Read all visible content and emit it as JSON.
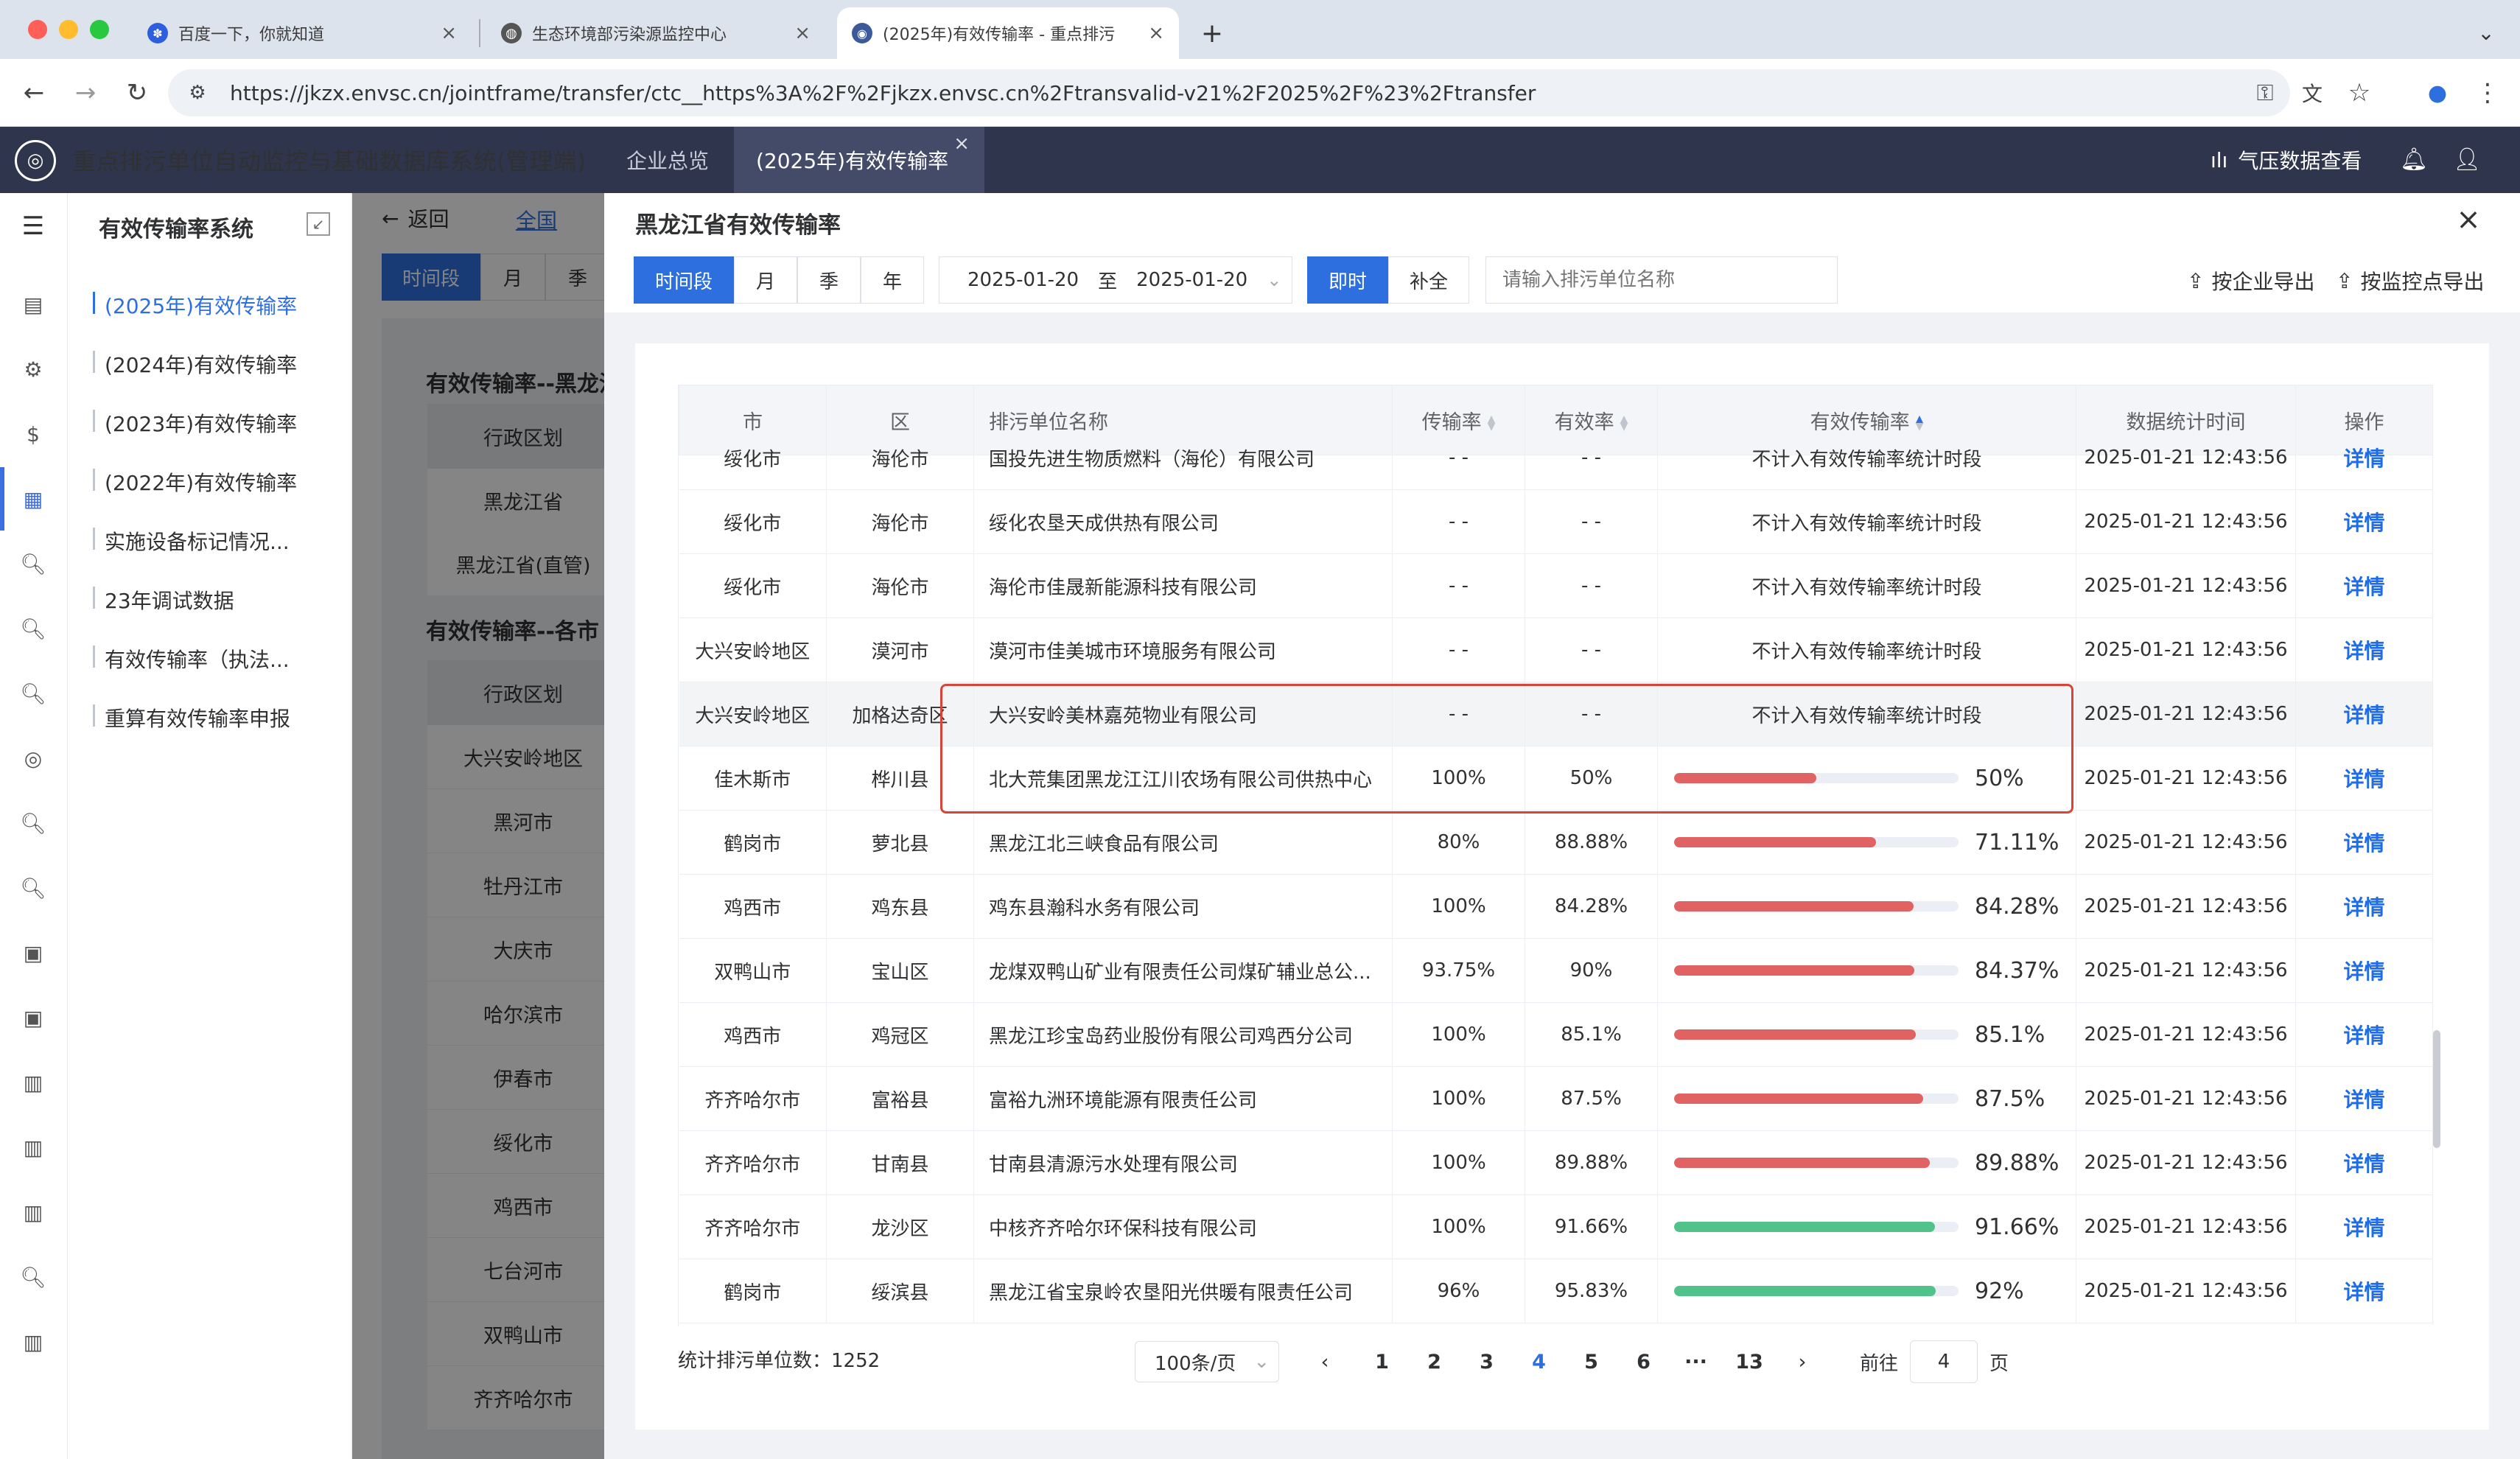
{
  "browser": {
    "tabs": [
      {
        "title": "百度一下，你就知道"
      },
      {
        "title": "生态环境部污染源监控中心"
      },
      {
        "title": "(2025年)有效传输率 - 重点排污"
      }
    ],
    "new_tab": "+",
    "url": "https://jkzx.envsc.cn/jointframe/transfer/ctc__https%3A%2F%2Fjkzx.envsc.cn%2Ftransvalid-v21%2F2025%2F%23%2Ftransfer"
  },
  "app": {
    "title": "重点排污单位自动监控与基础数据库系统(管理端)",
    "nav_tabs": [
      {
        "label": "企业总览"
      },
      {
        "label": "(2025年)有效传输率"
      }
    ],
    "pressure_link": "气压数据查看"
  },
  "submenu": {
    "title": "有效传输率系统",
    "items": [
      {
        "label": "(2025年)有效传输率"
      },
      {
        "label": "(2024年)有效传输率"
      },
      {
        "label": "(2023年)有效传输率"
      },
      {
        "label": "(2022年)有效传输率"
      },
      {
        "label": "实施设备标记情况..."
      },
      {
        "label": "23年调试数据"
      },
      {
        "label": "有效传输率（执法..."
      },
      {
        "label": "重算有效传输率申报"
      }
    ]
  },
  "background_page": {
    "back_label": "返回",
    "breadcrumb": "全国",
    "period_tabs": [
      "时间段",
      "月",
      "季"
    ],
    "section1_title": "有效传输率--黑龙江",
    "section1_header": "行政区划",
    "section1_rows": [
      "黑龙江省",
      "黑龙江省(直管)"
    ],
    "section2_title": "有效传输率--各市",
    "section2_header": "行政区划",
    "section2_rows": [
      "大兴安岭地区",
      "黑河市",
      "牡丹江市",
      "大庆市",
      "哈尔滨市",
      "伊春市",
      "绥化市",
      "鸡西市",
      "七台河市",
      "双鸭山市",
      "齐齐哈尔市"
    ]
  },
  "drawer": {
    "title": "黑龙江省有效传输率",
    "period_tabs": [
      "时间段",
      "月",
      "季",
      "年"
    ],
    "date_start": "2025-01-20",
    "date_sep": "至",
    "date_end": "2025-01-20",
    "mode_tabs": [
      "即时",
      "补全"
    ],
    "search_placeholder": "请输入排污单位名称",
    "export_by_company": "按企业导出",
    "export_by_point": "按监控点导出"
  },
  "table": {
    "headers": {
      "city": "市",
      "district": "区",
      "name": "排污单位名称",
      "transmission": "传输率",
      "validity": "有效率",
      "effective": "有效传输率",
      "stat_time": "数据统计时间",
      "action": "操作"
    },
    "detail_label": "详情",
    "rows": [
      {
        "city": "绥化市",
        "district": "海伦市",
        "name": "国投先进生物质燃料（海伦）有限公司",
        "transmission": "- -",
        "validity": "- -",
        "effective_text": "不计入有效传输率统计时段",
        "time": "2025-01-21 12:43:56"
      },
      {
        "city": "绥化市",
        "district": "海伦市",
        "name": "绥化农垦天成供热有限公司",
        "transmission": "- -",
        "validity": "- -",
        "effective_text": "不计入有效传输率统计时段",
        "time": "2025-01-21 12:43:56"
      },
      {
        "city": "绥化市",
        "district": "海伦市",
        "name": "海伦市佳晟新能源科技有限公司",
        "transmission": "- -",
        "validity": "- -",
        "effective_text": "不计入有效传输率统计时段",
        "time": "2025-01-21 12:43:56"
      },
      {
        "city": "大兴安岭地区",
        "district": "漠河市",
        "name": "漠河市佳美城市环境服务有限公司",
        "transmission": "- -",
        "validity": "- -",
        "effective_text": "不计入有效传输率统计时段",
        "time": "2025-01-21 12:43:56"
      },
      {
        "city": "大兴安岭地区",
        "district": "加格达奇区",
        "name": "大兴安岭美林嘉苑物业有限公司",
        "transmission": "- -",
        "validity": "- -",
        "effective_text": "不计入有效传输率统计时段",
        "time": "2025-01-21 12:43:56"
      },
      {
        "city": "佳木斯市",
        "district": "桦川县",
        "name": "北大荒集团黑龙江江川农场有限公司供热中心",
        "transmission": "100%",
        "validity": "50%",
        "effective_text": "50%",
        "effective_pct": 50,
        "bar_color": "#e06262",
        "time": "2025-01-21 12:43:56"
      },
      {
        "city": "鹤岗市",
        "district": "萝北县",
        "name": "黑龙江北三峡食品有限公司",
        "transmission": "80%",
        "validity": "88.88%",
        "effective_text": "71.11%",
        "effective_pct": 71.11,
        "bar_color": "#e06262",
        "time": "2025-01-21 12:43:56"
      },
      {
        "city": "鸡西市",
        "district": "鸡东县",
        "name": "鸡东县瀚科水务有限公司",
        "transmission": "100%",
        "validity": "84.28%",
        "effective_text": "84.28%",
        "effective_pct": 84.28,
        "bar_color": "#e06262",
        "time": "2025-01-21 12:43:56"
      },
      {
        "city": "双鸭山市",
        "district": "宝山区",
        "name": "龙煤双鸭山矿业有限责任公司煤矿辅业总公...",
        "transmission": "93.75%",
        "validity": "90%",
        "effective_text": "84.37%",
        "effective_pct": 84.37,
        "bar_color": "#e06262",
        "time": "2025-01-21 12:43:56"
      },
      {
        "city": "鸡西市",
        "district": "鸡冠区",
        "name": "黑龙江珍宝岛药业股份有限公司鸡西分公司",
        "transmission": "100%",
        "validity": "85.1%",
        "effective_text": "85.1%",
        "effective_pct": 85.1,
        "bar_color": "#e06262",
        "time": "2025-01-21 12:43:56"
      },
      {
        "city": "齐齐哈尔市",
        "district": "富裕县",
        "name": "富裕九洲环境能源有限责任公司",
        "transmission": "100%",
        "validity": "87.5%",
        "effective_text": "87.5%",
        "effective_pct": 87.5,
        "bar_color": "#e06262",
        "time": "2025-01-21 12:43:56"
      },
      {
        "city": "齐齐哈尔市",
        "district": "甘南县",
        "name": "甘南县清源污水处理有限公司",
        "transmission": "100%",
        "validity": "89.88%",
        "effective_text": "89.88%",
        "effective_pct": 89.88,
        "bar_color": "#e06262",
        "time": "2025-01-21 12:43:56"
      },
      {
        "city": "齐齐哈尔市",
        "district": "龙沙区",
        "name": "中核齐齐哈尔环保科技有限公司",
        "transmission": "100%",
        "validity": "91.66%",
        "effective_text": "91.66%",
        "effective_pct": 91.66,
        "bar_color": "#4fc38a",
        "time": "2025-01-21 12:43:56"
      },
      {
        "city": "鹤岗市",
        "district": "绥滨县",
        "name": "黑龙江省宝泉岭农垦阳光供暖有限责任公司",
        "transmission": "96%",
        "validity": "95.83%",
        "effective_text": "92%",
        "effective_pct": 92,
        "bar_color": "#4fc38a",
        "time": "2025-01-21 12:43:56"
      }
    ]
  },
  "pagination": {
    "total_label": "统计排污单位数：1252",
    "page_size": "100条/页",
    "pages": [
      "1",
      "2",
      "3",
      "4",
      "5",
      "6",
      "···",
      "13"
    ],
    "current_page": "4",
    "goto_prefix": "前往",
    "goto_value": "4",
    "goto_suffix": "页"
  },
  "colors": {
    "accent": "#2e6fe0",
    "appbar": "#2f354c",
    "highlight_box": "#d9443a",
    "bar_red": "#e06262",
    "bar_green": "#4fc38a"
  }
}
